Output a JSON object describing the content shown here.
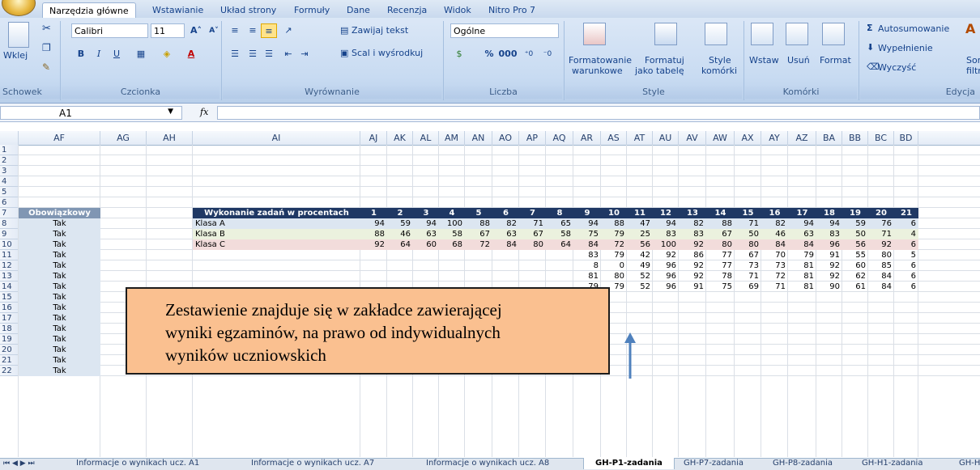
{
  "ribbon": {
    "tabs": [
      "Narzędzia główne",
      "Wstawianie",
      "Układ strony",
      "Formuły",
      "Dane",
      "Recenzja",
      "Widok",
      "Nitro Pro 7"
    ],
    "active_tab": "Narzędzia główne",
    "groups": {
      "clipboard": {
        "label": "Schowek",
        "paste": "Wklej"
      },
      "font": {
        "label": "Czcionka",
        "font_name": "Calibri",
        "font_size": "11"
      },
      "alignment": {
        "label": "Wyrównanie",
        "wrap": "Zawijaj tekst",
        "merge": "Scal i wyśrodkuj"
      },
      "number": {
        "label": "Liczba",
        "format": "Ogólne",
        "percent": "%",
        "thousands": "000"
      },
      "styles": {
        "label": "Style",
        "cond_format_1": "Formatowanie",
        "cond_format_2": "warunkowe",
        "format_table_1": "Formatuj",
        "format_table_2": "jako tabelę",
        "cell_styles_1": "Style",
        "cell_styles_2": "komórki"
      },
      "cells": {
        "label": "Komórki",
        "insert": "Wstaw",
        "delete": "Usuń",
        "format": "Format"
      },
      "editing": {
        "label": "Edycja",
        "autosum": "Autosumowanie",
        "fill": "Wypełnienie",
        "clear": "Wyczyść",
        "sort_1": "Sor",
        "sort_2": "filtr"
      }
    }
  },
  "formula_bar": {
    "name_box": "A1",
    "fx": "fx",
    "value": ""
  },
  "columns": [
    "AF",
    "AG",
    "AH",
    "AI",
    "AJ",
    "AK",
    "AL",
    "AM",
    "AN",
    "AO",
    "AP",
    "AQ",
    "AR",
    "AS",
    "AT",
    "AU",
    "AV",
    "AW",
    "AX",
    "AY",
    "AZ",
    "BA",
    "BB",
    "BC",
    "BD"
  ],
  "rows": [
    "1",
    "2",
    "3",
    "4",
    "5",
    "6",
    "7",
    "8",
    "9",
    "10",
    "11",
    "12",
    "13",
    "14",
    "15",
    "16",
    "17",
    "18",
    "19",
    "20",
    "21",
    "22"
  ],
  "sheet": {
    "header_af": "Obowiązkowy",
    "header_ai": "Wykonanie zadań w procentach",
    "task_numbers": [
      "1",
      "2",
      "3",
      "4",
      "5",
      "6",
      "7",
      "8",
      "9",
      "10",
      "11",
      "12",
      "13",
      "14",
      "15",
      "16",
      "17",
      "18",
      "19",
      "20",
      "21"
    ],
    "af_values": [
      "Tak",
      "Tak",
      "Tak",
      "Tak",
      "Tak",
      "Tak",
      "Tak",
      "Tak",
      "Tak",
      "Tak",
      "Tak",
      "Tak",
      "Tak",
      "Tak",
      "Tak"
    ],
    "classes": [
      {
        "name": "Klasa A",
        "values": [
          "94",
          "59",
          "94",
          "100",
          "88",
          "82",
          "71",
          "65",
          "94",
          "88",
          "47",
          "94",
          "82",
          "88",
          "71",
          "82",
          "94",
          "94",
          "59",
          "76",
          "6"
        ]
      },
      {
        "name": "Klasa B",
        "values": [
          "88",
          "46",
          "63",
          "58",
          "67",
          "63",
          "67",
          "58",
          "75",
          "79",
          "25",
          "83",
          "83",
          "67",
          "50",
          "46",
          "63",
          "83",
          "50",
          "71",
          "4"
        ]
      },
      {
        "name": "Klasa C",
        "values": [
          "92",
          "64",
          "60",
          "68",
          "72",
          "84",
          "80",
          "64",
          "84",
          "72",
          "56",
          "100",
          "92",
          "80",
          "80",
          "84",
          "84",
          "96",
          "56",
          "92",
          "6"
        ]
      },
      {
        "name": "",
        "values": [
          "",
          "",
          "",
          "",
          "",
          "",
          "",
          "",
          "83",
          "79",
          "42",
          "92",
          "86",
          "77",
          "67",
          "70",
          "79",
          "91",
          "55",
          "80",
          "5"
        ]
      },
      {
        "name": "",
        "values": [
          "",
          "",
          "",
          "",
          "",
          "",
          "",
          "",
          "8",
          "0",
          "49",
          "96",
          "92",
          "77",
          "73",
          "73",
          "81",
          "92",
          "60",
          "85",
          "6"
        ]
      },
      {
        "name": "",
        "values": [
          "",
          "",
          "",
          "",
          "",
          "",
          "",
          "",
          "81",
          "80",
          "52",
          "96",
          "92",
          "78",
          "71",
          "72",
          "81",
          "92",
          "62",
          "84",
          "6"
        ]
      },
      {
        "name": "",
        "values": [
          "",
          "",
          "",
          "",
          "",
          "",
          "",
          "",
          "79",
          "79",
          "52",
          "96",
          "91",
          "75",
          "69",
          "71",
          "81",
          "90",
          "61",
          "84",
          "6"
        ]
      }
    ]
  },
  "callout": {
    "line1": "Zestawienie znajduje się w zakładce zawierającej",
    "line2": "wyniki egzaminów, na prawo od indywidualnych",
    "line3": "wyników uczniowskich"
  },
  "sheet_tabs": [
    "Informacje o wynikach ucz. A1",
    "Informacje o wynikach ucz. A7",
    "Informacje o wynikach ucz. A8",
    "GH-P1-zadania",
    "GH-P7-zadania",
    "GH-P8-zadania",
    "GH-H1-zadania",
    "GH-H7-"
  ],
  "active_sheet": "GH-P1-zadania",
  "colors": {
    "header_dark": "#1f3864",
    "header_af": "#8096b3",
    "row_a": "#dce6f1",
    "row_b": "#ebf1de",
    "row_c": "#f2dcdb",
    "af_fill": "#dce6f1",
    "callout": "#fac090",
    "arrow": "#4f81bd"
  }
}
